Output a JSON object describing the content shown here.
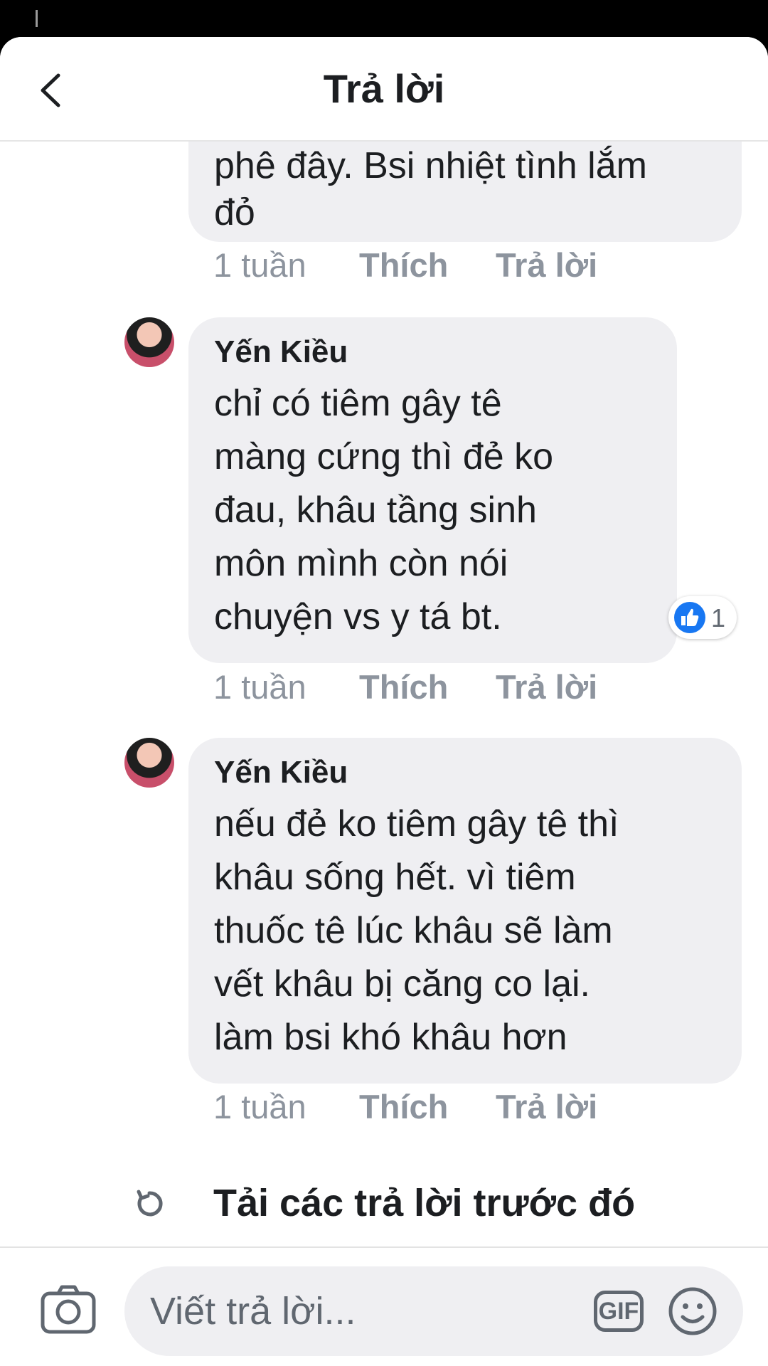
{
  "header": {
    "title": "Trả lời"
  },
  "comments": [
    {
      "author": "",
      "text": "phê đây. Bsi nhiệt tình lắm\nđỏ",
      "time": "1 tuần",
      "like": "Thích",
      "reply": "Trả lời"
    },
    {
      "author": "Yến Kiều",
      "text": "chỉ có tiêm gây tê\nmàng cứng thì đẻ ko\nđau, khâu tầng sinh\nmôn mình còn nói\nchuyện vs y tá bt.",
      "time": "1 tuần",
      "like": "Thích",
      "reply": "Trả lời",
      "reaction_count": "1"
    },
    {
      "author": "Yến Kiều",
      "text": "nếu đẻ ko tiêm gây tê thì\nkhâu sống hết. vì tiêm\nthuốc tê lúc khâu sẽ làm\nvết khâu bị căng co lại.\nlàm bsi khó khâu hơn",
      "time": "1 tuần",
      "like": "Thích",
      "reply": "Trả lời"
    }
  ],
  "load_previous": "Tải các trả lời trước đó",
  "composer": {
    "placeholder": "Viết trả lời...",
    "gif_label": "GIF"
  },
  "colors": {
    "accent": "#1877f2",
    "bubble": "#efeff2",
    "muted": "#8d949e"
  }
}
